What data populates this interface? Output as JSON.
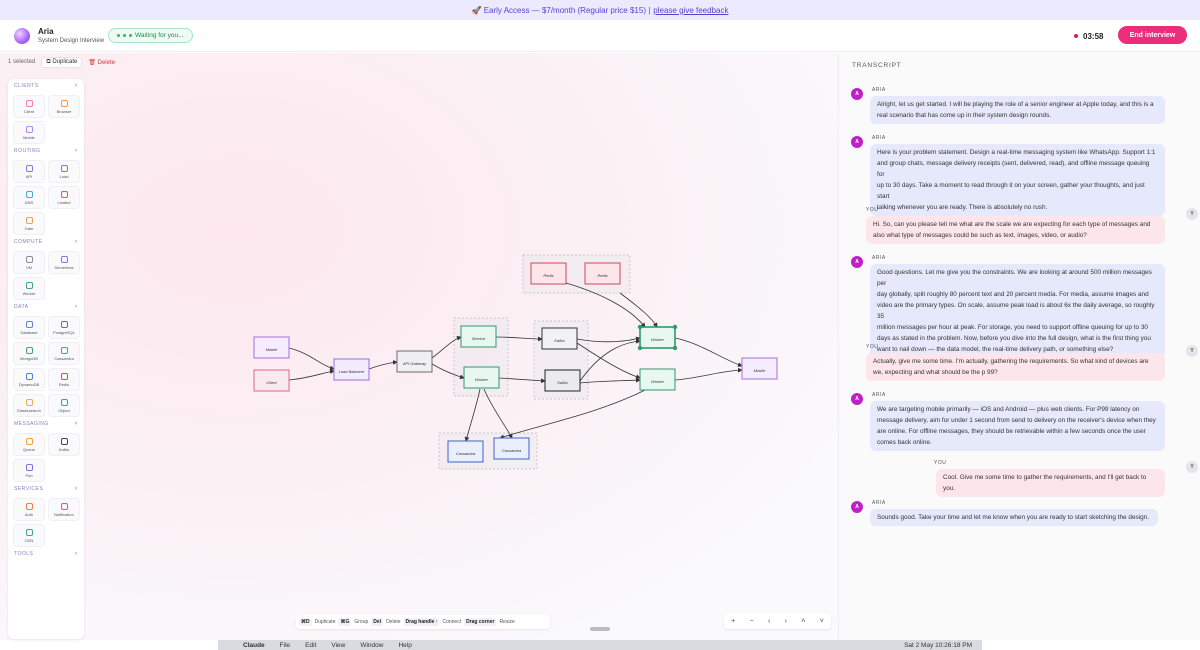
{
  "banner": {
    "text": "🚀 Early Access — $7/month (Regular price $15) |",
    "link": "please give feedback"
  },
  "header": {
    "agent_name": "Aria",
    "agent_subtitle": "System Design Interview",
    "status": "Waiting for you...",
    "timer": "03:58",
    "end_button": "End interview"
  },
  "toolbar": {
    "selected": "1 selected",
    "duplicate": "Duplicate",
    "delete": "Delete"
  },
  "palette": {
    "sections": [
      {
        "title": "CLIENTS",
        "items": [
          {
            "label": "Client",
            "color": "#ef7fb0"
          },
          {
            "label": "Browser",
            "color": "#f39a4a"
          },
          {
            "label": "Mobile",
            "color": "#b089f0"
          }
        ]
      },
      {
        "title": "ROUTING",
        "items": [
          {
            "label": "API",
            "color": "#7b7ef0"
          },
          {
            "label": "Load",
            "color": "#8b6cf0"
          },
          {
            "label": "DNS",
            "color": "#4aa3df"
          },
          {
            "label": "Limited",
            "color": "#e05757"
          },
          {
            "label": "Gate",
            "color": "#f0a05a"
          }
        ]
      },
      {
        "title": "COMPUTE",
        "items": [
          {
            "label": "VM",
            "color": "#8a8a96"
          },
          {
            "label": "Serverless",
            "color": "#8a6cf0"
          },
          {
            "label": "Worker",
            "color": "#3aaa7a"
          }
        ]
      },
      {
        "title": "DATA",
        "items": [
          {
            "label": "Database",
            "color": "#6a7de0"
          },
          {
            "label": "PostgreSQL",
            "color": "#5a6ad0"
          },
          {
            "label": "MongoDB",
            "color": "#3aaa6a"
          },
          {
            "label": "Cassandra",
            "color": "#5a8ad8"
          },
          {
            "label": "DynamoDB",
            "color": "#5a7ae0"
          },
          {
            "label": "Redis",
            "color": "#e04a4a"
          },
          {
            "label": "Elasticsearch",
            "color": "#f0b040"
          },
          {
            "label": "Object",
            "color": "#3a9ac0"
          }
        ]
      },
      {
        "title": "MESSAGING",
        "items": [
          {
            "label": "Queue",
            "color": "#f0a04a"
          },
          {
            "label": "Kafka",
            "color": "#444"
          },
          {
            "label": "Pub",
            "color": "#8a6ce0"
          }
        ]
      },
      {
        "title": "SERVICES",
        "items": [
          {
            "label": "Auth",
            "color": "#f07a4a"
          },
          {
            "label": "Notification",
            "color": "#e05a7a"
          },
          {
            "label": "CDN",
            "color": "#3aaa8a"
          }
        ]
      },
      {
        "title": "TOOLS",
        "items": []
      }
    ]
  },
  "shortcuts": [
    {
      "key": "⌘D",
      "label": "Duplicate"
    },
    {
      "key": "⌘G",
      "label": "Group"
    },
    {
      "key": "Del",
      "label": "Delete"
    },
    {
      "key": "Drag handle ·",
      "label": "Connect"
    },
    {
      "key": "Drag corner",
      "label": "Resize"
    }
  ],
  "zoom_controls": [
    "+",
    "−",
    "‹",
    "›",
    "˄",
    "˅"
  ],
  "diagram": {
    "nodes": [
      {
        "id": "n1",
        "label": "Mobile",
        "type": "client"
      },
      {
        "id": "n2",
        "label": "Client",
        "type": "client-pink"
      },
      {
        "id": "n3",
        "label": "Load Balancer",
        "type": "lb"
      },
      {
        "id": "n4",
        "label": "API Gateway",
        "type": "vm"
      },
      {
        "id": "n5",
        "label": "Service",
        "type": "worker"
      },
      {
        "id": "n6",
        "label": "Worker",
        "type": "worker"
      },
      {
        "id": "n7",
        "label": "Kafka",
        "type": "kafka"
      },
      {
        "id": "n8",
        "label": "Kafka",
        "type": "kafka-dark"
      },
      {
        "id": "n9",
        "label": "Worker",
        "type": "worker"
      },
      {
        "id": "n10",
        "label": "Worker",
        "type": "worker"
      },
      {
        "id": "n11",
        "label": "Redis",
        "type": "redis"
      },
      {
        "id": "n12",
        "label": "Redis",
        "type": "redis"
      },
      {
        "id": "n13",
        "label": "Cassandra",
        "type": "db"
      },
      {
        "id": "n14",
        "label": "Cassandra",
        "type": "db"
      },
      {
        "id": "n15",
        "label": "Mobile",
        "type": "client"
      }
    ]
  },
  "transcript": {
    "title": "TRANSCRIPT",
    "messages": [
      {
        "speaker": "ARIA",
        "avatar": "A",
        "text": [
          "Alright, let us get started. I will be playing the role of a senior engineer at Apple today, and this is a",
          "real scenario that has come up in their system design rounds."
        ]
      },
      {
        "speaker": "ARIA",
        "avatar": "A",
        "text": [
          "Here is your problem statement. Design a real-time messaging system like WhatsApp. Support 1:1",
          "and group chats, message delivery receipts (sent, delivered, read), and offline message queuing for",
          "up to 30 days. Take a moment to read through it on your screen, gather your thoughts, and just start",
          "talking whenever you are ready. There is absolutely no rush."
        ]
      },
      {
        "speaker": "YOU",
        "avatar": "Y",
        "text": [
          "Hi. So, can you please tell me what are the scale we are expecting for each type of messages and",
          "also what type of messages could be such as text, images, video, or audio?"
        ]
      },
      {
        "speaker": "ARIA",
        "avatar": "A",
        "text": [
          "Good questions. Let me give you the constraints. We are looking at around 500 million messages per",
          "day globally, split roughly 80 percent text and 20 percent media. For media, assume images and",
          "video are the primary types. On scale, assume peak load is about 6x the daily average, so roughly 35",
          "million messages per hour at peak. For storage, you need to support offline queuing for up to 30",
          "days as stated in the problem. Now, before you dive into the full design, what is the first thing you",
          "want to nail down — the data model, the real-time delivery path, or something else?"
        ]
      },
      {
        "speaker": "YOU",
        "avatar": "Y",
        "text": [
          "Actually, give me some time. I'm actually, gathering the requirements. So what kind of devices are",
          "we, expecting and what should be the p 99?"
        ]
      },
      {
        "speaker": "ARIA",
        "avatar": "A",
        "text": [
          "We are targeting mobile primarily — iOS and Android — plus web clients. For P99 latency on",
          "message delivery, aim for under 1 second from send to delivery on the receiver's device when they",
          "are online. For offline messages, they should be retrievable within a few seconds once the user",
          "comes back online."
        ]
      },
      {
        "speaker": "YOU",
        "avatar": "Y",
        "text": [
          "Cool. Give me some time to gather the requirements, and I'll get back to you."
        ]
      },
      {
        "speaker": "ARIA",
        "avatar": "A",
        "text": [
          "Sounds good. Take your time and let me know when you are ready to start sketching the design."
        ]
      }
    ]
  },
  "dock": {
    "app": "Claude",
    "menus": [
      "File",
      "Edit",
      "View",
      "Window",
      "Help"
    ],
    "clock": "Sat 2 May  10:26:18 PM"
  }
}
